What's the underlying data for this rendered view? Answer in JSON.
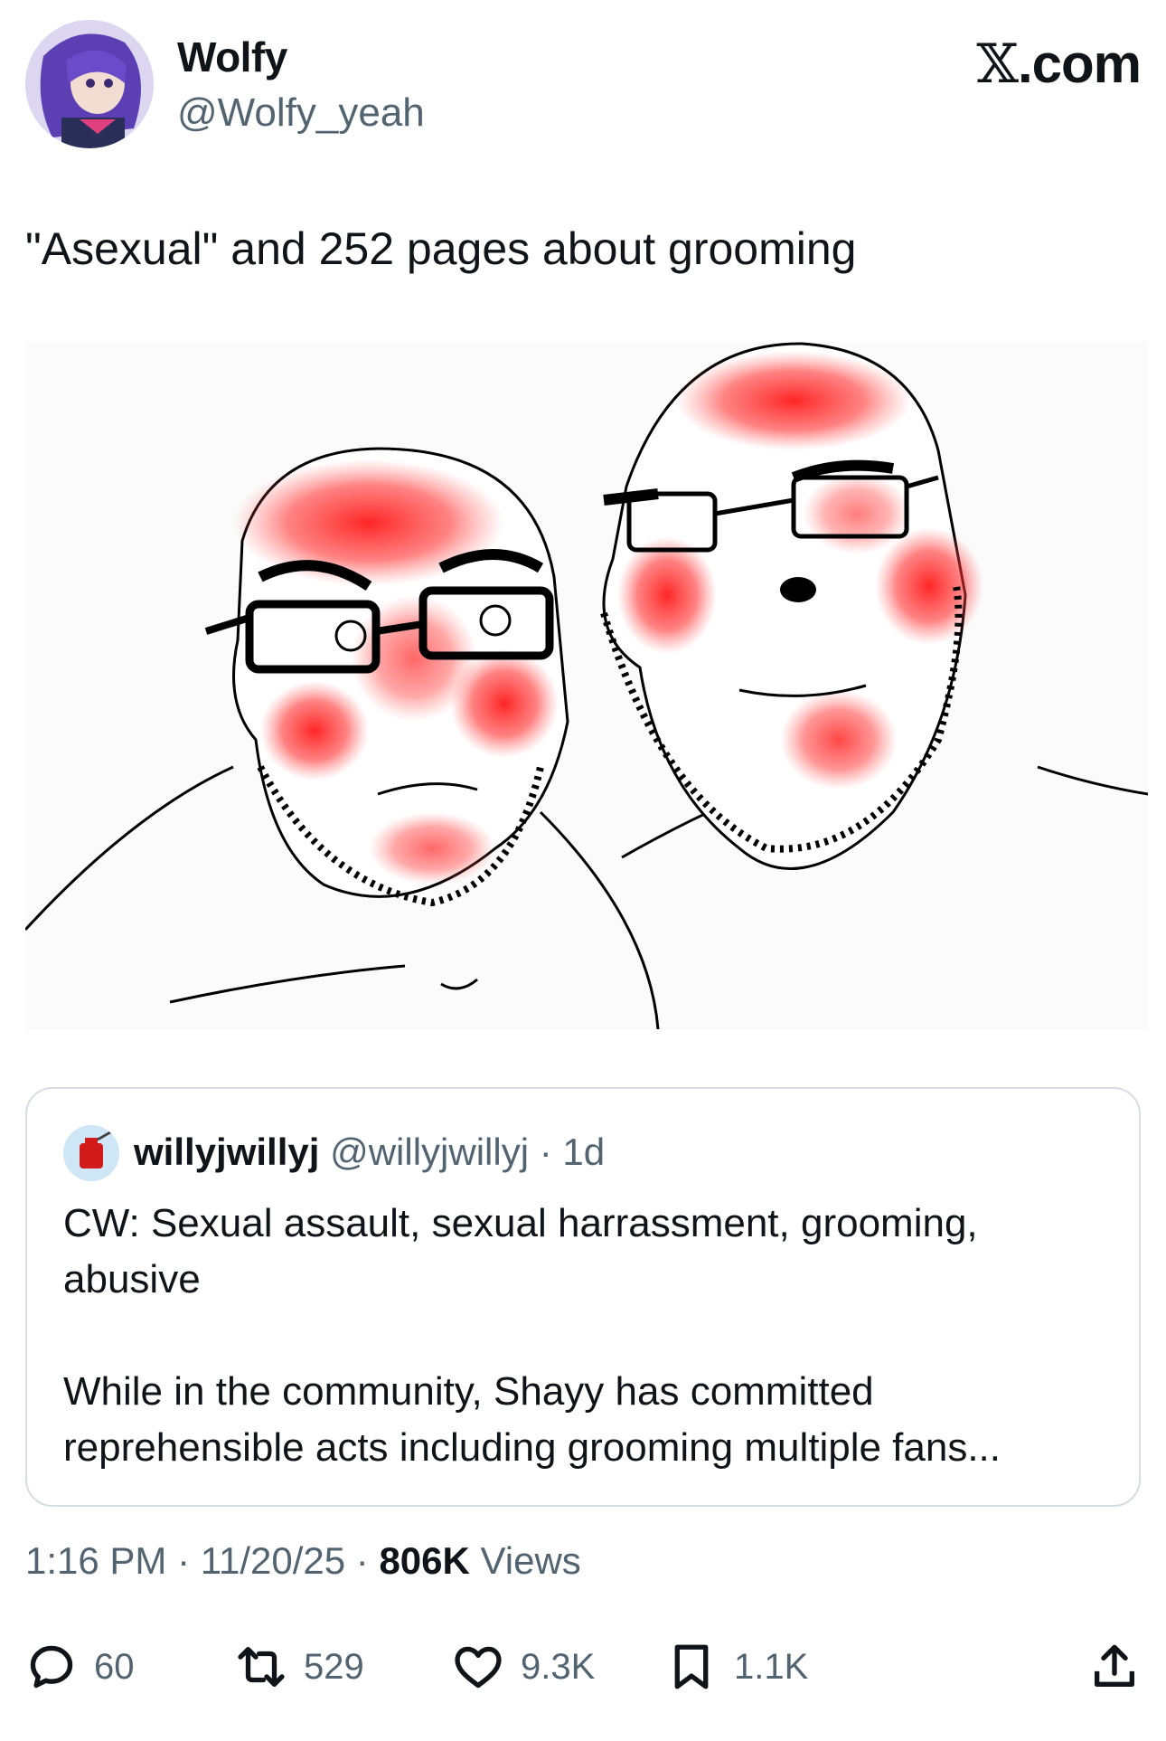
{
  "author": {
    "name": "Wolfy",
    "handle": "@Wolfy_yeah"
  },
  "site": {
    "logo_x": "𝕏",
    "logo_text": ".com"
  },
  "tweet": {
    "text": "\"Asexual\" and 252 pages about grooming"
  },
  "quote": {
    "name": "willyjwillyj",
    "handle": "@willyjwillyj",
    "sep": " · ",
    "age": "1d",
    "line1": "CW: Sexual assault, sexual harrassment, grooming, abusive",
    "line2": "While in the community, Shayy has committed reprehensible acts including grooming multiple fans..."
  },
  "meta": {
    "time": "1:16 PM",
    "sep1": " · ",
    "date": "11/20/25",
    "sep2": " · ",
    "views_count": "806K",
    "views_label": " Views"
  },
  "actions": {
    "replies": "60",
    "reposts": "529",
    "likes": "9.3K",
    "bookmarks": "1.1K"
  },
  "icons": [
    "reply-icon",
    "repost-icon",
    "like-icon",
    "bookmark-icon",
    "share-icon"
  ],
  "colors": {
    "text": "#0f1419",
    "secondary": "#536471",
    "border": "#d6dde2",
    "blush": "#ff1a1a"
  }
}
